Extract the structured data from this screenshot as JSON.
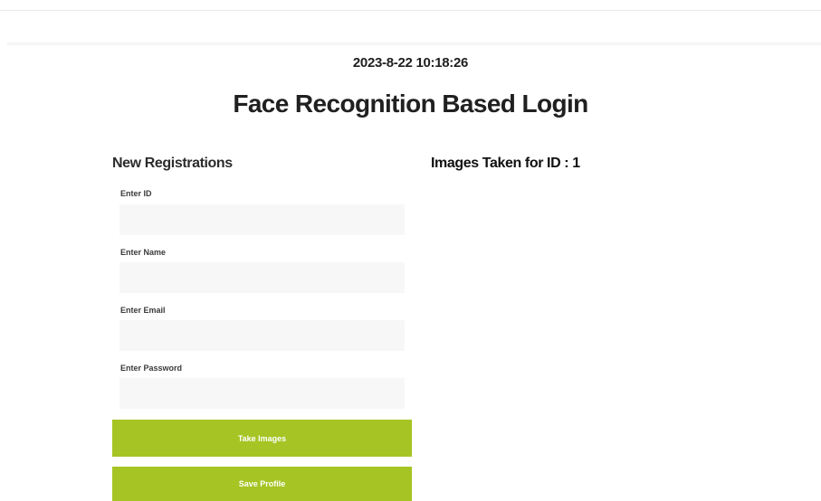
{
  "header": {
    "datetime": "2023-8-22 10:18:26",
    "title": "Face Recognition Based Login"
  },
  "registration": {
    "title": "New Registrations",
    "fields": [
      {
        "label": "Enter ID",
        "value": "",
        "placeholder": ""
      },
      {
        "label": "Enter Name",
        "value": "",
        "placeholder": ""
      },
      {
        "label": "Enter Email",
        "value": "",
        "placeholder": ""
      },
      {
        "label": "Enter Password",
        "value": "",
        "placeholder": ""
      }
    ],
    "take_images_label": "Take Images",
    "save_profile_label": "Save Profile"
  },
  "images_panel": {
    "title": "Images Taken for ID : 1"
  },
  "colors": {
    "accent": "#a6c423",
    "input_background": "#f7f7f7"
  }
}
